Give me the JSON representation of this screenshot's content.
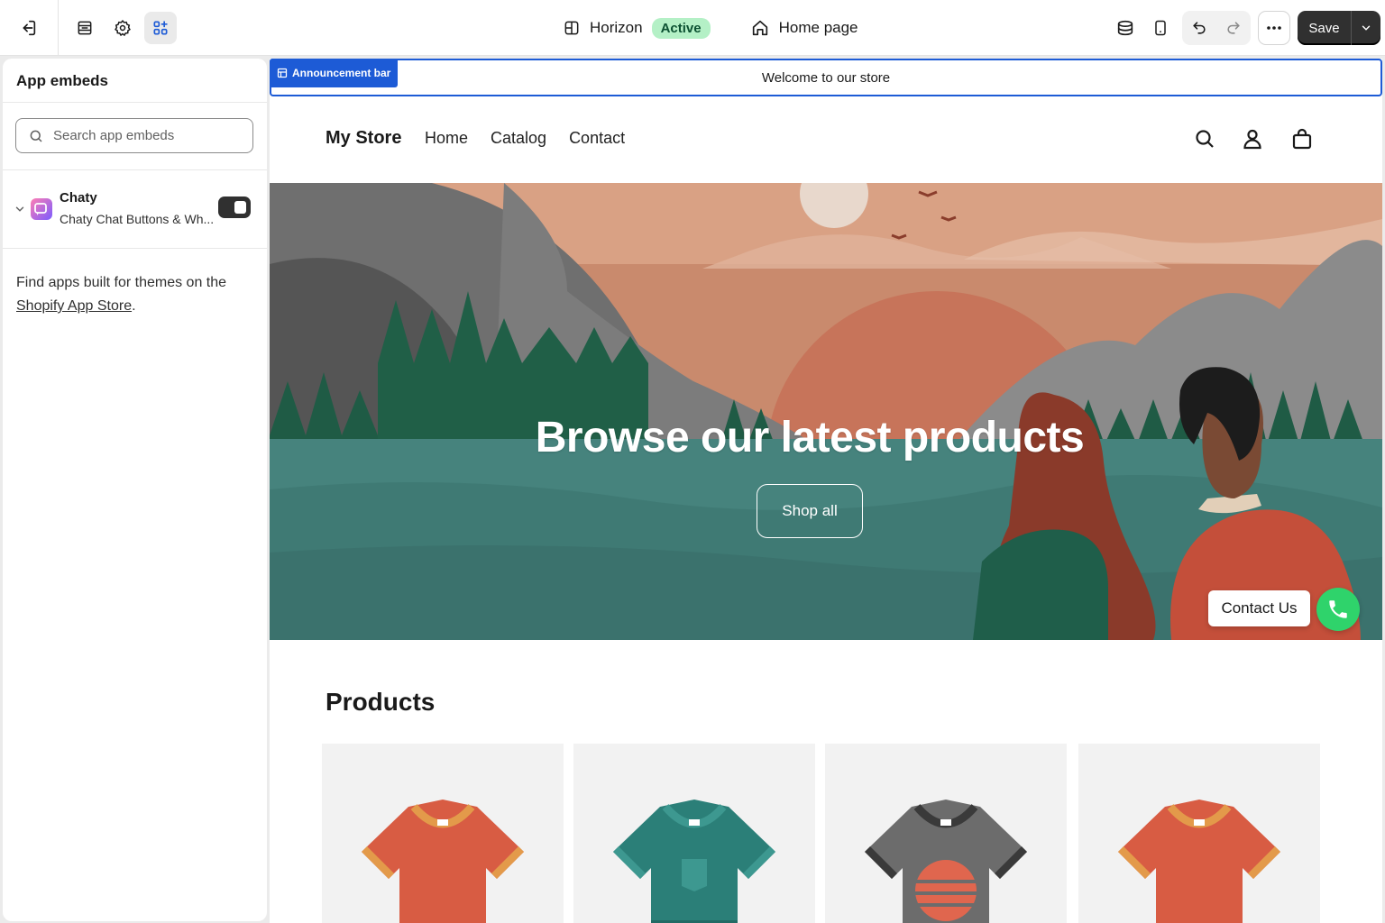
{
  "topbar": {
    "theme_name": "Horizon",
    "theme_status": "Active",
    "page_name": "Home page",
    "save_label": "Save",
    "icons": [
      "exit-icon",
      "sections-icon",
      "settings-icon",
      "app-embeds-icon",
      "theme-icon",
      "home-icon",
      "desktop-view-icon",
      "mobile-view-icon",
      "undo-icon",
      "redo-icon",
      "more-icon",
      "chevron-down-icon"
    ]
  },
  "panel": {
    "title": "App embeds",
    "search_placeholder": "Search app embeds",
    "embeds": [
      {
        "name": "Chaty",
        "description": "Chaty Chat Buttons & Wh...",
        "enabled": true
      }
    ],
    "find_text": "Find apps built for themes on the",
    "find_link": "Shopify App Store",
    "find_suffix": "."
  },
  "preview": {
    "announcement_tag": "Announcement bar",
    "announcement_text": "Welcome to our store",
    "store_name": "My Store",
    "nav": [
      "Home",
      "Catalog",
      "Contact"
    ],
    "hero_title": "Browse our latest products",
    "hero_button": "Shop all",
    "chat_label": "Contact Us",
    "products_title": "Products"
  },
  "colors": {
    "accent_blue": "#1d5bd6",
    "active_badge_bg": "#b4f0c6",
    "save_bg": "#303030",
    "chat_green": "#2fd36b"
  }
}
